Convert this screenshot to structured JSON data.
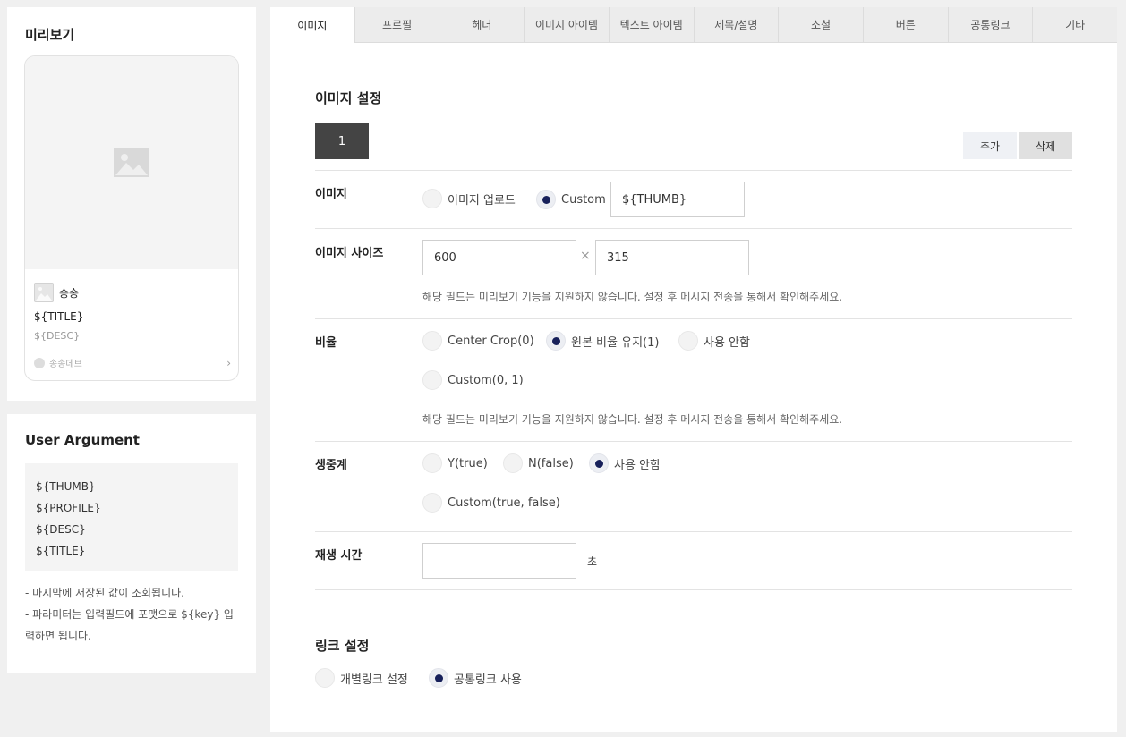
{
  "preview": {
    "title": "미리보기",
    "profile_name": "송송",
    "card_title": "${TITLE}",
    "card_desc": "${DESC}",
    "footer_text": "송송데브",
    "footer_arrow": "›"
  },
  "user_argument": {
    "title": "User Argument",
    "args": [
      "${THUMB}",
      "${PROFILE}",
      "${DESC}",
      "${TITLE}"
    ],
    "notes": [
      "- 마지막에 저장된 값이 조회됩니다.",
      "- 파라미터는 입력필드에 포맷으로 ${key} 입력하면 됩니다."
    ]
  },
  "tabs": [
    "이미지",
    "프로필",
    "헤더",
    "이미지 아이템",
    "텍스트 아이템",
    "제목/설명",
    "소셜",
    "버튼",
    "공통링크",
    "기타"
  ],
  "image_settings": {
    "title": "이미지 설정",
    "slot_label": "1",
    "add_label": "추가",
    "delete_label": "삭제",
    "image": {
      "label": "이미지",
      "options": [
        "이미지 업로드",
        "Custom"
      ],
      "selected": "Custom",
      "custom_value": "${THUMB}"
    },
    "size": {
      "label": "이미지 사이즈",
      "width": "600",
      "height": "315",
      "times": "×",
      "hint": "해당 필드는 미리보기 기능을 지원하지 않습니다. 설정 후 메시지 전송을 통해서 확인해주세요."
    },
    "ratio": {
      "label": "비율",
      "options": [
        "Center Crop(0)",
        "원본 비율 유지(1)",
        "사용 안함",
        "Custom(0, 1)"
      ],
      "selected": "원본 비율 유지(1)",
      "hint": "해당 필드는 미리보기 기능을 지원하지 않습니다. 설정 후 메시지 전송을 통해서 확인해주세요."
    },
    "live": {
      "label": "생중계",
      "options": [
        "Y(true)",
        "N(false)",
        "사용 안함",
        "Custom(true, false)"
      ],
      "selected": "사용 안함"
    },
    "playtime": {
      "label": "재생 시간",
      "value": "",
      "unit": "초"
    }
  },
  "link_settings": {
    "title": "링크 설정",
    "options": [
      "개별링크 설정",
      "공통링크 사용"
    ],
    "selected": "공통링크 사용"
  },
  "colors": {
    "radio_selected": "#17205a",
    "slot_button": "#444444",
    "page_bg": "#f0f0f0"
  }
}
